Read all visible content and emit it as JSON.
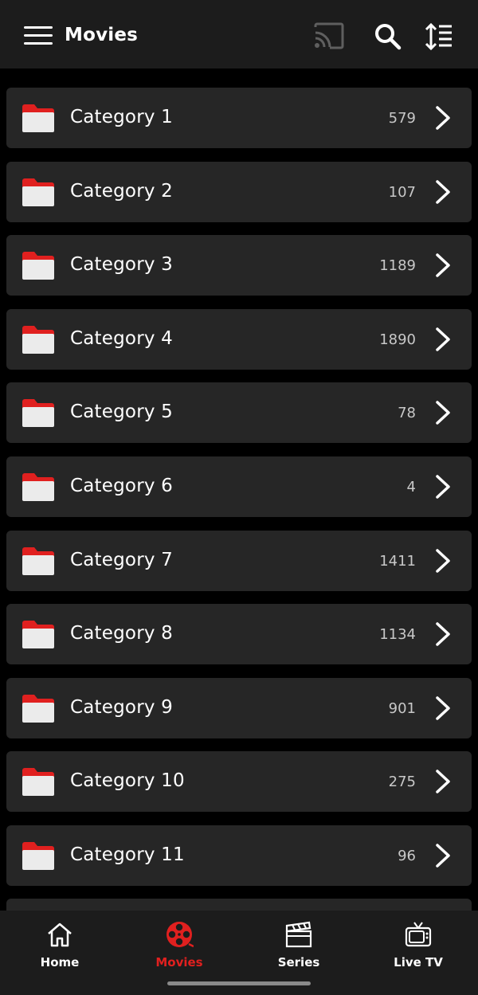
{
  "header": {
    "title": "Movies",
    "icons": [
      "menu-icon",
      "cast-icon",
      "search-icon",
      "sort-icon"
    ]
  },
  "colors": {
    "background": "#000000",
    "bar": "#1c1c1c",
    "row": "#262626",
    "accent": "#e0201f"
  },
  "categories": [
    {
      "label": "Category 1",
      "count": "579"
    },
    {
      "label": "Category 2",
      "count": "107"
    },
    {
      "label": "Category 3",
      "count": "1189"
    },
    {
      "label": "Category 4",
      "count": "1890"
    },
    {
      "label": "Category 5",
      "count": "78"
    },
    {
      "label": "Category 6",
      "count": "4"
    },
    {
      "label": "Category 7",
      "count": "1411"
    },
    {
      "label": "Category 8",
      "count": "1134"
    },
    {
      "label": "Category 9",
      "count": "901"
    },
    {
      "label": "Category 10",
      "count": "275"
    },
    {
      "label": "Category 11",
      "count": "96"
    }
  ],
  "bottom_nav": [
    {
      "label": "Home",
      "icon": "home-icon",
      "active": false
    },
    {
      "label": "Movies",
      "icon": "film-reel-icon",
      "active": true
    },
    {
      "label": "Series",
      "icon": "clapperboard-icon",
      "active": false
    },
    {
      "label": "Live TV",
      "icon": "tv-icon",
      "active": false
    }
  ]
}
